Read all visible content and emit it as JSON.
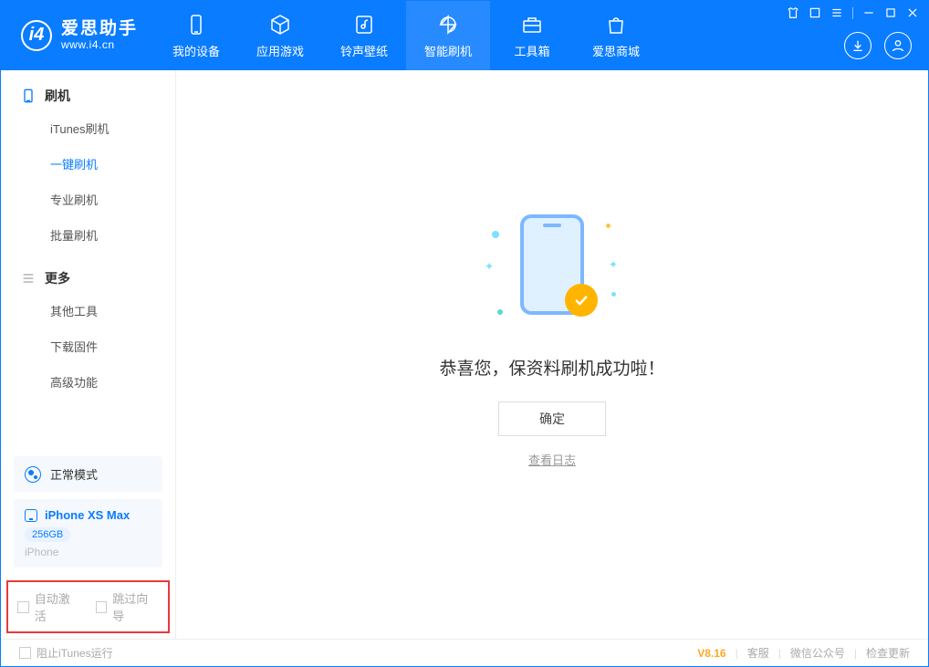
{
  "app": {
    "name": "爱思助手",
    "url": "www.i4.cn"
  },
  "nav": [
    {
      "label": "我的设备"
    },
    {
      "label": "应用游戏"
    },
    {
      "label": "铃声壁纸"
    },
    {
      "label": "智能刷机"
    },
    {
      "label": "工具箱"
    },
    {
      "label": "爱思商城"
    }
  ],
  "sidebar": {
    "group1_title": "刷机",
    "items1": [
      {
        "label": "iTunes刷机"
      },
      {
        "label": "一键刷机"
      },
      {
        "label": "专业刷机"
      },
      {
        "label": "批量刷机"
      }
    ],
    "group2_title": "更多",
    "items2": [
      {
        "label": "其他工具"
      },
      {
        "label": "下载固件"
      },
      {
        "label": "高级功能"
      }
    ],
    "mode_text": "正常模式",
    "device": {
      "name": "iPhone XS Max",
      "storage": "256GB",
      "type": "iPhone"
    },
    "bottom_checks": {
      "auto_activate": "自动激活",
      "skip_guide": "跳过向导"
    }
  },
  "content": {
    "success_message": "恭喜您，保资料刷机成功啦！",
    "ok_button": "确定",
    "view_log": "查看日志"
  },
  "footer": {
    "block_itunes": "阻止iTunes运行",
    "version": "V8.16",
    "links": {
      "service": "客服",
      "wechat": "微信公众号",
      "update": "检查更新"
    }
  }
}
